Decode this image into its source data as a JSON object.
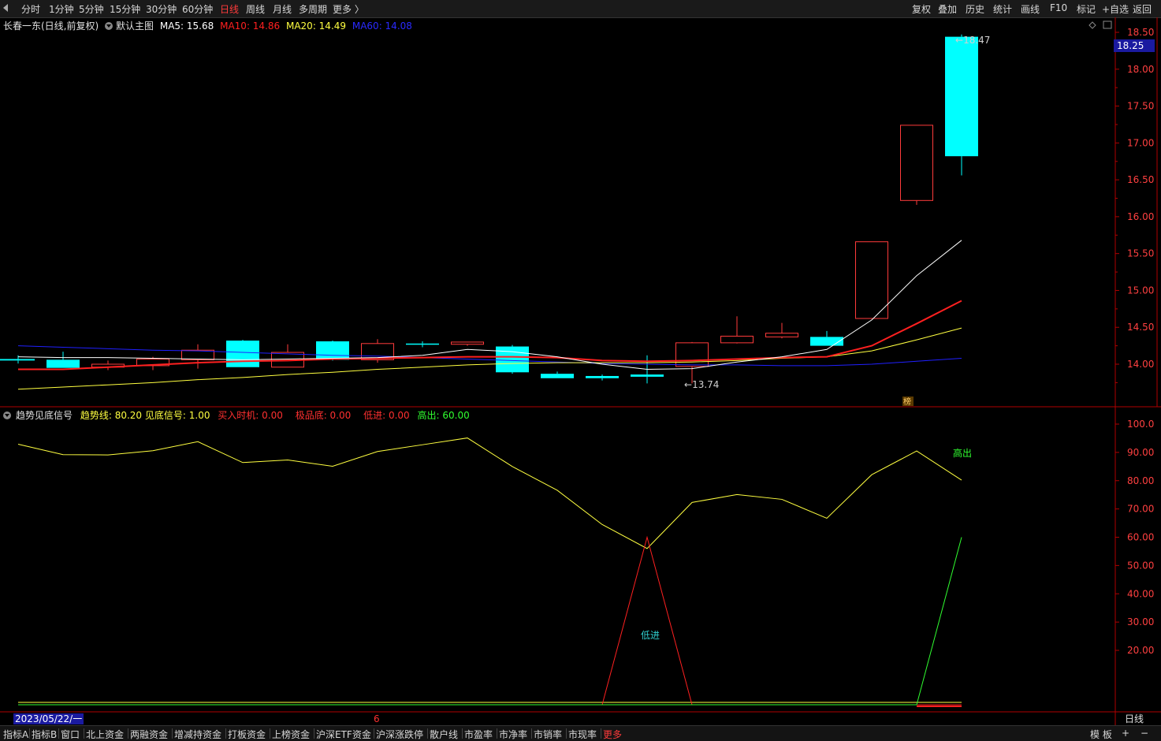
{
  "toolbar": {
    "periods": [
      "分时",
      "1分钟",
      "5分钟",
      "15分钟",
      "30分钟",
      "60分钟",
      "日线",
      "周线",
      "月线",
      "多周期",
      "更多 〉"
    ],
    "active_period": "日线",
    "actions": [
      "复权",
      "叠加",
      "历史",
      "统计",
      "画线",
      "F10",
      "标记",
      "+自选",
      "返回"
    ]
  },
  "main_chart": {
    "stock_title": "长春一东(日线,前复权)",
    "template": "默认主图",
    "ma5": "MA5: 15.68",
    "ma10": "MA10: 14.86",
    "ma20": "MA20: 14.49",
    "ma60": "MA60: 14.08",
    "current_price": "18.25",
    "high_label": "18.47",
    "low_label": "13.74",
    "badge": "榜",
    "y_ticks": [
      "18.50",
      "18.00",
      "17.50",
      "17.00",
      "16.50",
      "16.00",
      "15.50",
      "15.00",
      "14.50",
      "14.00"
    ]
  },
  "indicator": {
    "name": "趋势见底信号",
    "trend": "趋势线: 80.20",
    "bottom_signal": "见底信号: 1.00",
    "buy_timing": "买入时机: 0.00",
    "extreme_bottom": "极品底: 0.00",
    "low_entry": "低进: 0.00",
    "high_exit": "高出: 60.00",
    "label_low": "低进",
    "label_high": "高出",
    "y_ticks": [
      "100.0",
      "90.00",
      "80.00",
      "70.00",
      "60.00",
      "50.00",
      "40.00",
      "30.00",
      "20.00"
    ]
  },
  "date_axis": {
    "start_date": "2023/05/22/一",
    "month_marker": "6",
    "period_label": "日线"
  },
  "bottom_tabs": [
    "指标A",
    "指标B",
    "窗口",
    "北上资金",
    "两融资金",
    "增减持资金",
    "打板资金",
    "上榜资金",
    "沪深ETF资金",
    "沪深涨跌停",
    "散户线",
    "市盈率",
    "市净率",
    "市销率",
    "市现率",
    "更多"
  ],
  "bottom_right": [
    "模 板",
    "+",
    "−"
  ],
  "colors": {
    "up": "#ff3b3b",
    "down": "#00ffff",
    "ma5": "#ffffff",
    "ma10": "#ff2020",
    "ma20": "#ffff40",
    "ma60": "#2020ff",
    "trend_line": "#ffff40",
    "axis_red": "#b00000"
  },
  "chart_data": [
    {
      "type": "candlestick",
      "candles": [
        {
          "o": 14.07,
          "h": 14.12,
          "l": 14.01,
          "c": 14.05
        },
        {
          "o": 14.06,
          "h": 14.17,
          "l": 13.95,
          "c": 13.95
        },
        {
          "o": 13.96,
          "h": 14.05,
          "l": 13.92,
          "c": 14.0
        },
        {
          "o": 13.98,
          "h": 14.1,
          "l": 13.92,
          "c": 14.07
        },
        {
          "o": 14.06,
          "h": 14.27,
          "l": 13.94,
          "c": 14.19
        },
        {
          "o": 14.32,
          "h": 14.33,
          "l": 13.96,
          "c": 13.96
        },
        {
          "o": 13.96,
          "h": 14.27,
          "l": 13.96,
          "c": 14.16
        },
        {
          "o": 14.31,
          "h": 14.32,
          "l": 14.05,
          "c": 14.06
        },
        {
          "o": 14.06,
          "h": 14.34,
          "l": 14.02,
          "c": 14.28
        },
        {
          "o": 14.28,
          "h": 14.31,
          "l": 14.23,
          "c": 14.27
        },
        {
          "o": 14.27,
          "h": 14.3,
          "l": 14.25,
          "c": 14.3
        },
        {
          "o": 14.24,
          "h": 14.26,
          "l": 13.87,
          "c": 13.89
        },
        {
          "o": 13.87,
          "h": 13.9,
          "l": 13.81,
          "c": 13.81
        },
        {
          "o": 13.84,
          "h": 13.86,
          "l": 13.78,
          "c": 13.81
        },
        {
          "o": 13.86,
          "h": 14.12,
          "l": 13.74,
          "c": 13.83
        },
        {
          "o": 13.97,
          "h": 14.3,
          "l": 13.74,
          "c": 14.29
        },
        {
          "o": 14.29,
          "h": 14.65,
          "l": 14.28,
          "c": 14.38
        },
        {
          "o": 14.37,
          "h": 14.56,
          "l": 14.35,
          "c": 14.42
        },
        {
          "o": 14.37,
          "h": 14.45,
          "l": 14.25,
          "c": 14.25
        },
        {
          "o": 14.62,
          "h": 15.66,
          "l": 14.62,
          "c": 15.66
        },
        {
          "o": 16.22,
          "h": 17.24,
          "l": 16.16,
          "c": 17.24
        },
        {
          "o": 18.44,
          "h": 18.47,
          "l": 16.56,
          "c": 16.82
        }
      ],
      "ma5": [
        14.1,
        14.09,
        14.09,
        14.08,
        14.07,
        14.06,
        14.07,
        14.08,
        14.09,
        14.12,
        14.2,
        14.17,
        14.1,
        14.0,
        13.93,
        13.94,
        14.03,
        14.1,
        14.2,
        14.6,
        15.2,
        15.68
      ],
      "ma10": [
        13.93,
        13.93,
        13.96,
        13.99,
        14.02,
        14.04,
        14.05,
        14.07,
        14.08,
        14.09,
        14.1,
        14.1,
        14.09,
        14.05,
        14.04,
        14.05,
        14.07,
        14.09,
        14.1,
        14.25,
        14.55,
        14.86
      ],
      "ma20": [
        13.66,
        13.69,
        13.72,
        13.75,
        13.79,
        13.82,
        13.86,
        13.89,
        13.93,
        13.96,
        13.99,
        14.01,
        14.02,
        14.02,
        14.02,
        14.03,
        14.05,
        14.08,
        14.1,
        14.18,
        14.33,
        14.49
      ],
      "ma60": [
        14.25,
        14.23,
        14.21,
        14.19,
        14.18,
        14.16,
        14.14,
        14.12,
        14.11,
        14.09,
        14.07,
        14.05,
        14.03,
        14.01,
        14.0,
        13.99,
        13.99,
        13.98,
        13.98,
        14.0,
        14.04,
        14.08
      ],
      "ylim": [
        13.5,
        18.6
      ]
    },
    {
      "type": "line",
      "name": "趋势见底信号",
      "series": [
        {
          "name": "趋势线",
          "values": [
            92.9,
            89.2,
            89.1,
            90.6,
            93.8,
            86.4,
            87.3,
            85.1,
            90.3,
            92.7,
            95.1,
            85.0,
            76.6,
            64.5,
            56.0,
            72.3,
            75.1,
            73.4,
            66.7,
            82.1,
            90.5,
            80.2
          ]
        },
        {
          "name": "低进",
          "values": [
            0,
            0,
            0,
            0,
            0,
            0,
            0,
            0,
            0,
            0,
            0,
            0,
            0,
            0,
            60,
            0,
            0,
            0,
            0,
            0,
            0,
            0
          ]
        },
        {
          "name": "高出",
          "values": [
            0,
            0,
            0,
            0,
            0,
            0,
            0,
            0,
            0,
            0,
            0,
            0,
            0,
            0,
            0,
            0,
            0,
            0,
            0,
            0,
            0,
            60
          ]
        }
      ],
      "ylim": [
        0,
        105
      ]
    }
  ]
}
